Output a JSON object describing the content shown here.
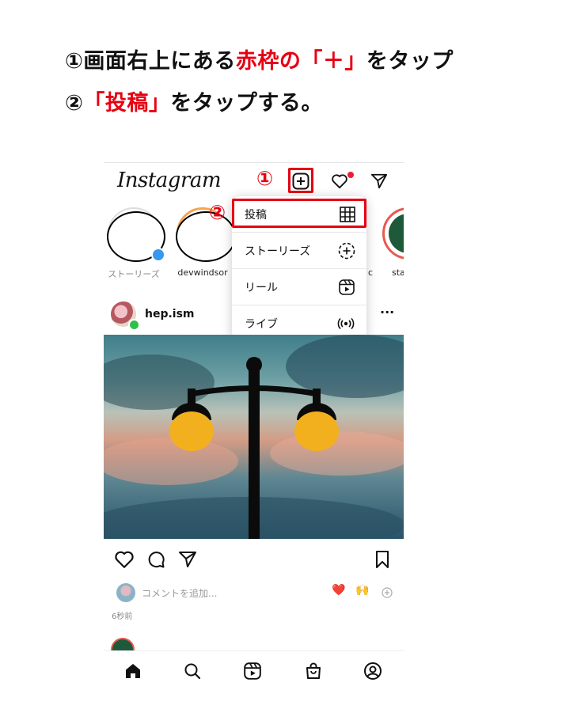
{
  "instructions": {
    "line1": {
      "prefix": "①画面右上にある",
      "highlight": "赤枠の「＋」",
      "suffix": "をタップ"
    },
    "line2": {
      "prefix": "②",
      "highlight": "「投稿」",
      "suffix": "をタップする。"
    }
  },
  "markers": {
    "step1": "①",
    "step2": "②"
  },
  "app": {
    "brand": "Instagram"
  },
  "stories": [
    {
      "label": "ストーリーズ"
    },
    {
      "label": "devwindsor"
    },
    {
      "label": "c"
    },
    {
      "label": "sta"
    }
  ],
  "menu": {
    "items": [
      {
        "label": "投稿",
        "icon": "grid-icon"
      },
      {
        "label": "ストーリーズ",
        "icon": "story-add-icon"
      },
      {
        "label": "リール",
        "icon": "reels-icon"
      },
      {
        "label": "ライブ",
        "icon": "live-icon"
      }
    ]
  },
  "post": {
    "username": "hep.ism",
    "more": "···",
    "comment_placeholder": "コメントを追加...",
    "emoji1": "❤️",
    "emoji2": "🙌",
    "time": "6秒前"
  },
  "colors": {
    "accent_red": "#e60012",
    "notif": "#ed1b3a",
    "online": "#2fc04a",
    "text": "#111111"
  }
}
